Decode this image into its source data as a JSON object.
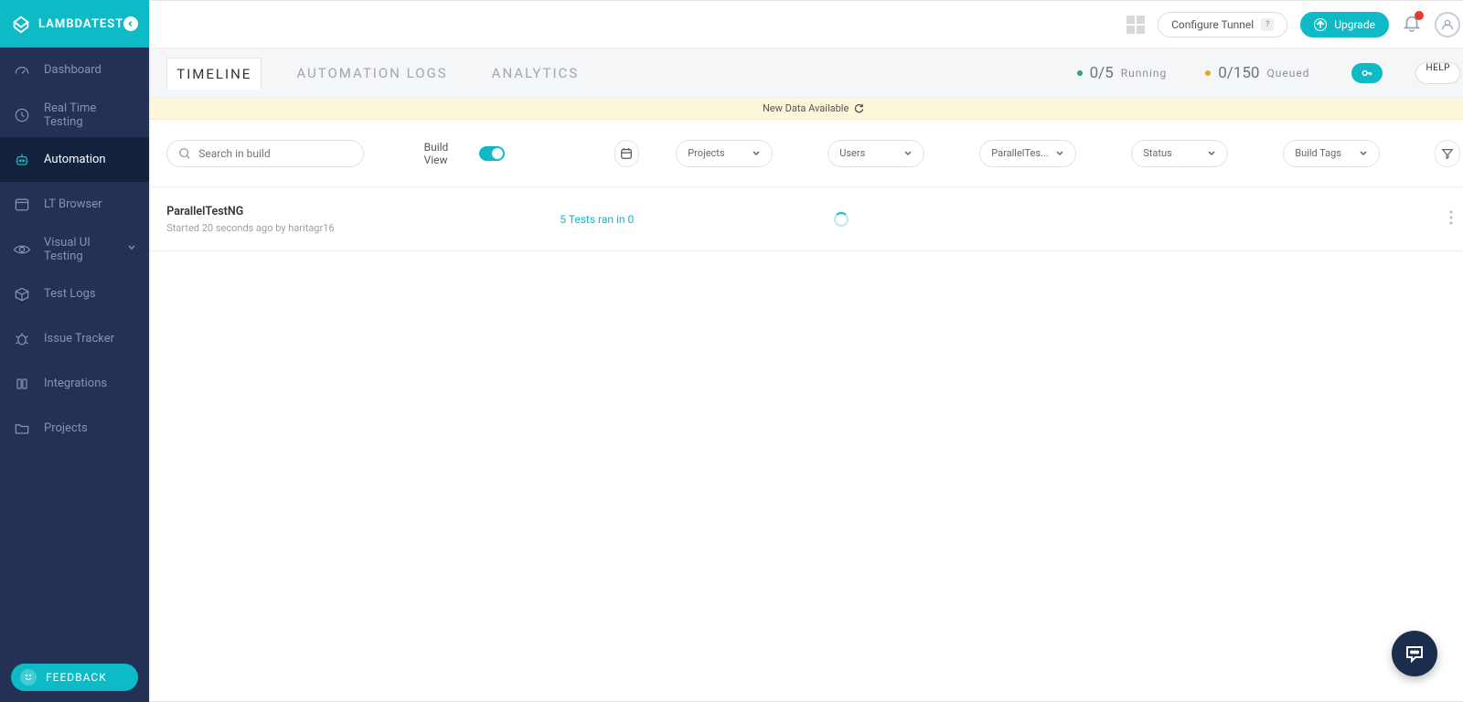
{
  "brand": {
    "name": "LAMBDATEST"
  },
  "sidebar": {
    "items": [
      {
        "label": "Dashboard"
      },
      {
        "label": "Real Time Testing"
      },
      {
        "label": "Automation"
      },
      {
        "label": "LT Browser"
      },
      {
        "label": "Visual UI Testing"
      },
      {
        "label": "Test Logs"
      },
      {
        "label": "Issue Tracker"
      },
      {
        "label": "Integrations"
      },
      {
        "label": "Projects"
      }
    ],
    "feedback": "FEEDBACK"
  },
  "topbar": {
    "configure_tunnel": "Configure Tunnel",
    "upgrade": "Upgrade"
  },
  "tabs": {
    "timeline": "TIMELINE",
    "automation_logs": "AUTOMATION LOGS",
    "analytics": "ANALYTICS",
    "running": {
      "count": "0/5",
      "label": "Running"
    },
    "queued": {
      "count": "0/150",
      "label": "Queued"
    },
    "help": "HELP"
  },
  "banner": {
    "text": "New Data Available"
  },
  "filters": {
    "search_placeholder": "Search in build",
    "build_view": "Build View",
    "projects": "Projects",
    "users": "Users",
    "parallel": "ParallelTes...",
    "status": "Status",
    "build_tags": "Build Tags"
  },
  "build": {
    "name": "ParallelTestNG",
    "meta": "Started 20 seconds ago by haritagr16",
    "tests": "5 Tests ran in 0"
  }
}
